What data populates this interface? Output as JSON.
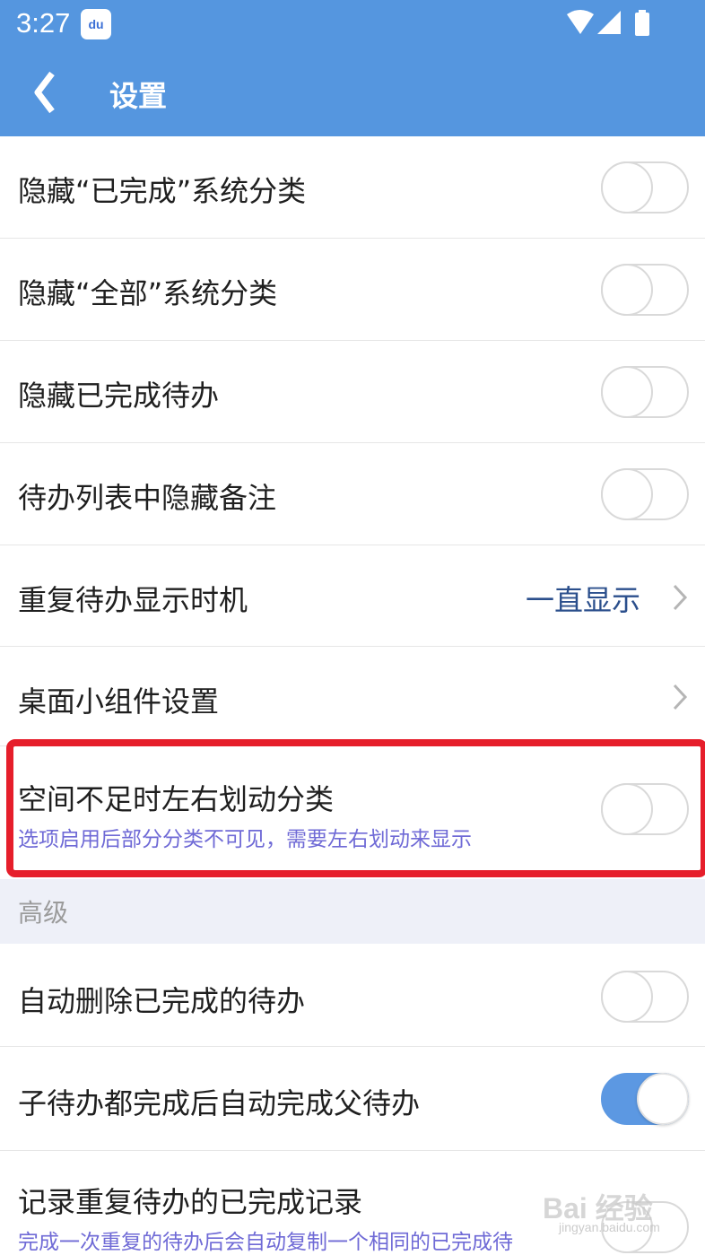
{
  "status_bar": {
    "time": "3:27",
    "app_icon_text": "du"
  },
  "header": {
    "title": "设置",
    "back_icon": "chevron-left-icon"
  },
  "settings": [
    {
      "label": "隐藏“已完成”系统分类",
      "toggle": false
    },
    {
      "label": "隐藏“全部”系统分类",
      "toggle": false
    },
    {
      "label": "隐藏已完成待办",
      "toggle": false
    },
    {
      "label": "待办列表中隐藏备注",
      "toggle": false
    },
    {
      "label": "重复待办显示时机",
      "value": "一直显示",
      "chevron": true
    },
    {
      "label": "桌面小组件设置",
      "chevron": true
    },
    {
      "label": "空间不足时左右划动分类",
      "sublabel": "选项启用后部分分类不可见，需要左右划动来显示",
      "toggle": false,
      "highlighted": true
    }
  ],
  "advanced": {
    "section_title": "高级",
    "items": [
      {
        "label": "自动删除已完成的待办",
        "toggle": false
      },
      {
        "label": "子待办都完成后自动完成父待办",
        "toggle": true
      },
      {
        "label": "记录重复待办的已完成记录",
        "sublabel": "完成一次重复的待办后会自动复制一个相同的已完成待",
        "toggle": false
      }
    ]
  },
  "watermark": {
    "text": "Bai 经验",
    "sub": "jingyan.baidu.com"
  },
  "colors": {
    "accent": "#5596df",
    "highlight_border": "#e61e2b",
    "toggle_on": "#5c98e2"
  }
}
